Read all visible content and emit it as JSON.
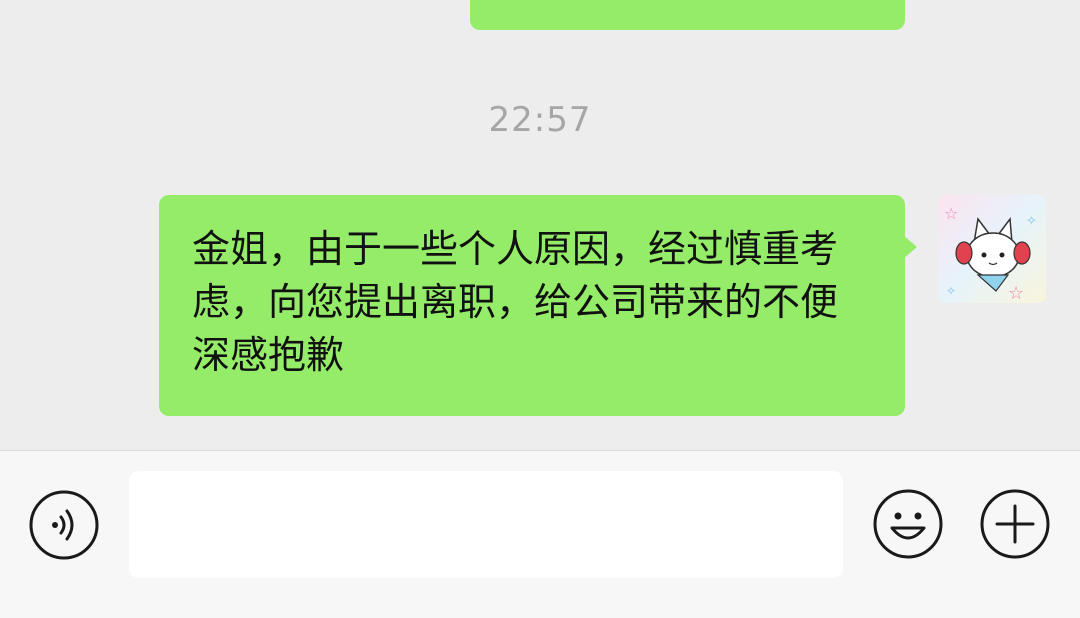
{
  "chat": {
    "timestamp": "22:57",
    "message": {
      "text": "金姐，由于一些个人原因，经过慎重考虑，向您提出离职，给公司带来的不便深感抱歉",
      "bubble_color": "#95ec69"
    }
  },
  "input_bar": {
    "input_value": "",
    "voice_icon": "voice-icon",
    "emoji_icon": "emoji-icon",
    "plus_icon": "plus-icon"
  },
  "colors": {
    "background": "#ededed",
    "bubble": "#95ec69",
    "timestamp": "#a6a6a6",
    "icon_stroke": "#1a1a1a"
  }
}
